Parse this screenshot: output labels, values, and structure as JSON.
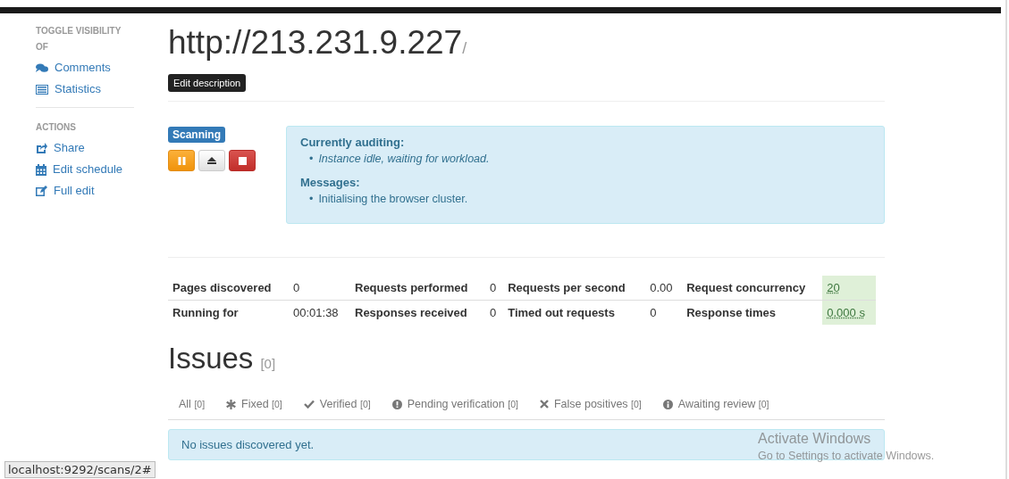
{
  "sidebar": {
    "sections": [
      {
        "heading": "TOGGLE VISIBILITY OF",
        "items": [
          {
            "kind": "comments",
            "label": "Comments"
          },
          {
            "kind": "table",
            "label": "Statistics"
          }
        ]
      },
      {
        "heading": "ACTIONS",
        "items": [
          {
            "kind": "share",
            "label": "Share"
          },
          {
            "kind": "calendar",
            "label": "Edit schedule"
          },
          {
            "kind": "edit",
            "label": "Full edit"
          }
        ]
      }
    ]
  },
  "scan": {
    "url": "http://213.231.9.227",
    "url_suffix": "/",
    "edit_button": "Edit description",
    "status": "Scanning",
    "controls": [
      {
        "kind": "pause"
      },
      {
        "kind": "eject"
      },
      {
        "kind": "stop"
      }
    ],
    "info": [
      {
        "heading": "Currently auditing:",
        "items": [
          {
            "bullet": "•",
            "text": "Instance idle, waiting for workload.",
            "italic": true
          }
        ]
      },
      {
        "heading": "Messages:",
        "items": [
          {
            "bullet": "•",
            "text": "Initialising the browser cluster.",
            "italic": false
          }
        ]
      }
    ]
  },
  "stats": {
    "rows": [
      [
        {
          "label": "Pages discovered",
          "value": "0",
          "highlight": false
        },
        {
          "label": "Requests performed",
          "value": "0",
          "highlight": false
        },
        {
          "label": "Requests per second",
          "value": "0.00",
          "highlight": false
        },
        {
          "label": "Request concurrency",
          "value": "20",
          "highlight": true
        }
      ],
      [
        {
          "label": "Running for",
          "value": "00:01:38",
          "highlight": false
        },
        {
          "label": "Responses received",
          "value": "0",
          "highlight": false
        },
        {
          "label": "Timed out requests",
          "value": "0",
          "highlight": false
        },
        {
          "label": "Response times",
          "value": "0.000 s",
          "highlight": true
        }
      ]
    ]
  },
  "issues": {
    "title": "Issues",
    "count": "[0]",
    "tabs": [
      {
        "kind": "none",
        "label": "All",
        "count": "[0]"
      },
      {
        "kind": "asterisk",
        "label": "Fixed",
        "count": "[0]"
      },
      {
        "kind": "check",
        "label": "Verified",
        "count": "[0]"
      },
      {
        "kind": "exclamation",
        "label": "Pending verification",
        "count": "[0]"
      },
      {
        "kind": "cross",
        "label": "False positives",
        "count": "[0]"
      },
      {
        "kind": "info",
        "label": "Awaiting review",
        "count": "[0]"
      }
    ],
    "message": "No issues discovered yet."
  },
  "os_notice": {
    "title": "Activate Windows",
    "subtitle": "Go to Settings to activate Windows."
  },
  "status_bar": {
    "url": "localhost:9292/scans/2#"
  }
}
